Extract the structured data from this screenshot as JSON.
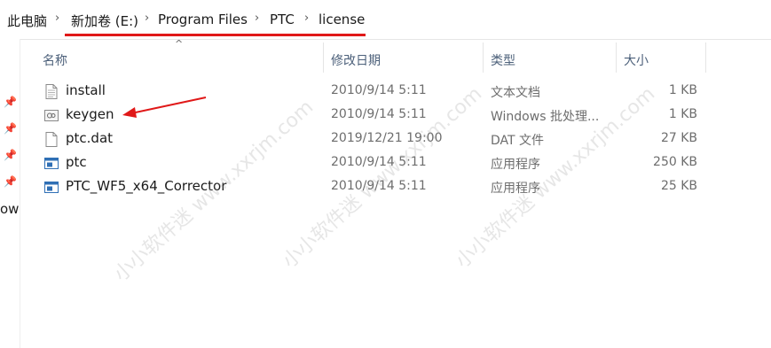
{
  "address_bar": {
    "crumbs": [
      "此电脑",
      "新加卷 (E:)",
      "Program Files",
      "PTC",
      "license"
    ],
    "separator": "›",
    "highlight_color": "#e01818"
  },
  "nav_pane": {
    "partial_text": "ow"
  },
  "columns": {
    "name": "名称",
    "date": "修改日期",
    "type": "类型",
    "size": "大小"
  },
  "files": [
    {
      "name": "install",
      "date": "2010/9/14 5:11",
      "type": "文本文档",
      "size": "1 KB",
      "icon": "text-document-icon"
    },
    {
      "name": "keygen",
      "date": "2010/9/14 5:11",
      "type": "Windows 批处理...",
      "size": "1 KB",
      "icon": "batch-file-icon"
    },
    {
      "name": "ptc.dat",
      "date": "2019/12/21 19:00",
      "type": "DAT 文件",
      "size": "27 KB",
      "icon": "generic-file-icon"
    },
    {
      "name": "ptc",
      "date": "2010/9/14 5:11",
      "type": "应用程序",
      "size": "250 KB",
      "icon": "application-icon"
    },
    {
      "name": "PTC_WF5_x64_Corrector",
      "date": "2010/9/14 5:11",
      "type": "应用程序",
      "size": "25 KB",
      "icon": "application-icon"
    }
  ],
  "annotation": {
    "color": "#e01818"
  },
  "watermark": {
    "text": "小小软件迷 www.xxrjm.com",
    "color": "#8c8c8c"
  }
}
